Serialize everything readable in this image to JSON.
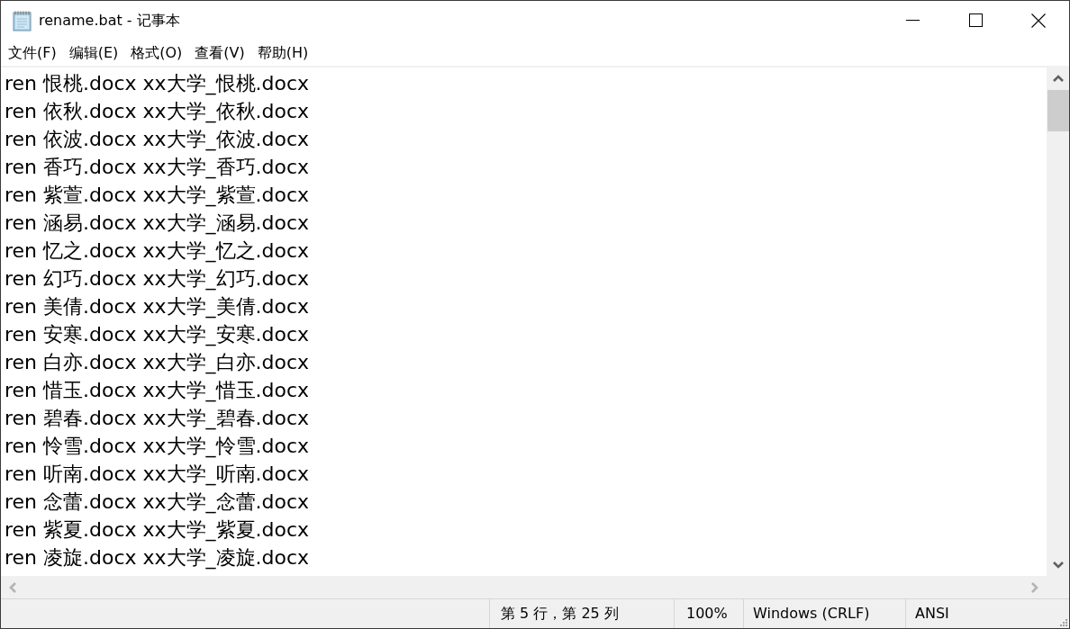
{
  "window": {
    "title": "rename.bat - 记事本"
  },
  "menu_bar": [
    "文件(F)",
    "编辑(E)",
    "格式(O)",
    "查看(V)",
    "帮助(H)"
  ],
  "editor": {
    "lines": [
      "ren 恨桃.docx xx大学_恨桃.docx",
      "ren 依秋.docx xx大学_依秋.docx",
      "ren 依波.docx xx大学_依波.docx",
      "ren 香巧.docx xx大学_香巧.docx",
      "ren 紫萱.docx xx大学_紫萱.docx",
      "ren 涵易.docx xx大学_涵易.docx",
      "ren 忆之.docx xx大学_忆之.docx",
      "ren 幻巧.docx xx大学_幻巧.docx",
      "ren 美倩.docx xx大学_美倩.docx",
      "ren 安寒.docx xx大学_安寒.docx",
      "ren 白亦.docx xx大学_白亦.docx",
      "ren 惜玉.docx xx大学_惜玉.docx",
      "ren 碧春.docx xx大学_碧春.docx",
      "ren 怜雪.docx xx大学_怜雪.docx",
      "ren 听南.docx xx大学_听南.docx",
      "ren 念蕾.docx xx大学_念蕾.docx",
      "ren 紫夏.docx xx大学_紫夏.docx",
      "ren 凌旋.docx xx大学_凌旋.docx"
    ]
  },
  "status_bar": {
    "cursor_position": "第 5 行，第 25 列",
    "zoom": "100%",
    "line_ending": "Windows (CRLF)",
    "encoding": "ANSI"
  }
}
